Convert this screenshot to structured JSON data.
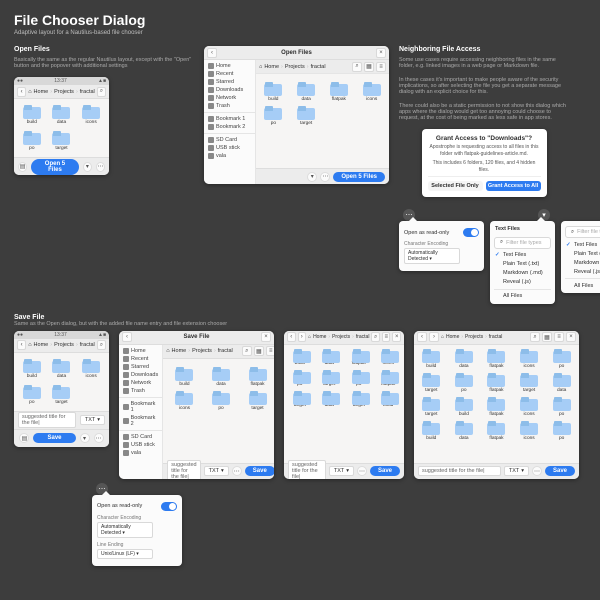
{
  "page": {
    "title": "File Chooser Dialog",
    "subtitle": "Adaptive layout for a Nautilus-based file chooser"
  },
  "open": {
    "heading": "Open Files",
    "desc": "Basically the same as the regular Nautilus layout, except with the \"Open\" button and the popover with additional settings",
    "time": "13:37",
    "crumbs": [
      "Home",
      "Projects",
      "fractal"
    ],
    "files": [
      "build",
      "data",
      "icons",
      "po",
      "target"
    ],
    "files_wide": [
      "build",
      "data",
      "flatpak",
      "icons",
      "po",
      "target"
    ],
    "sidebar": [
      "Home",
      "Recent",
      "Starred",
      "Downloads",
      "Network",
      "Trash",
      "Bookmark 1",
      "Bookmark 2",
      "SD Card",
      "USB stick",
      "vala"
    ],
    "open_btn": "Open 5 Files",
    "wide_title": "Open Files"
  },
  "neighbor": {
    "heading": "Neighboring File Access",
    "desc1": "Some use cases require accessing neighboring files in the same folder, e.g. linked images in a web page or Markdown file.",
    "desc2": "In these cases it's important to make people aware of the security implications, so after selecting the file you get a separate message dialog with an explicit choice for this.",
    "desc3": "There could also be a static permission to not show this dialog which apps where the dialog would get too annoying could choose to request, at the cost of being marked as less safe in app stores.",
    "msg": {
      "title": "Grant Access to \"Downloads\"?",
      "body": "Apostrophe is requesting access to all files in this folder with flatpak-guidelines-article.md.",
      "meta": "This includes 6 folders, 120 files, and 4 hidden files.",
      "btn_sel": "Selected File Only",
      "btn_all": "Grant Access to All"
    }
  },
  "pop_open": {
    "readonly": "Open as read-only",
    "enc_label": "Character Encoding",
    "enc_val": "Automatically Detected"
  },
  "filter": {
    "title": "Text Files",
    "search_ph": "Filter file types",
    "items": [
      "Text Files",
      "Plain Text (.txt)",
      "Markdown (.md)",
      "Reveal (.js)"
    ],
    "all": "All Files"
  },
  "save": {
    "heading": "Save File",
    "desc": "Same as the Open dialog, but with the added file name entry and file extension chooser",
    "title": "Save File",
    "placeholder": "suggested title for the file|",
    "ext": "TXT",
    "btn": "Save",
    "files_wide": [
      "build",
      "data",
      "flatpak",
      "icons",
      "po",
      "target",
      "po",
      "flatpak",
      "target",
      "data",
      "target",
      "build",
      "flatpak",
      "icons",
      "po",
      "build",
      "data",
      "flatpak",
      "icons",
      "po"
    ]
  },
  "pop_save": {
    "readonly": "Open as read-only",
    "enc_label": "Character Encoding",
    "enc_val": "Automatically Detected",
    "le_label": "Line Ending",
    "le_val": "Unix/Linux (LF)"
  }
}
